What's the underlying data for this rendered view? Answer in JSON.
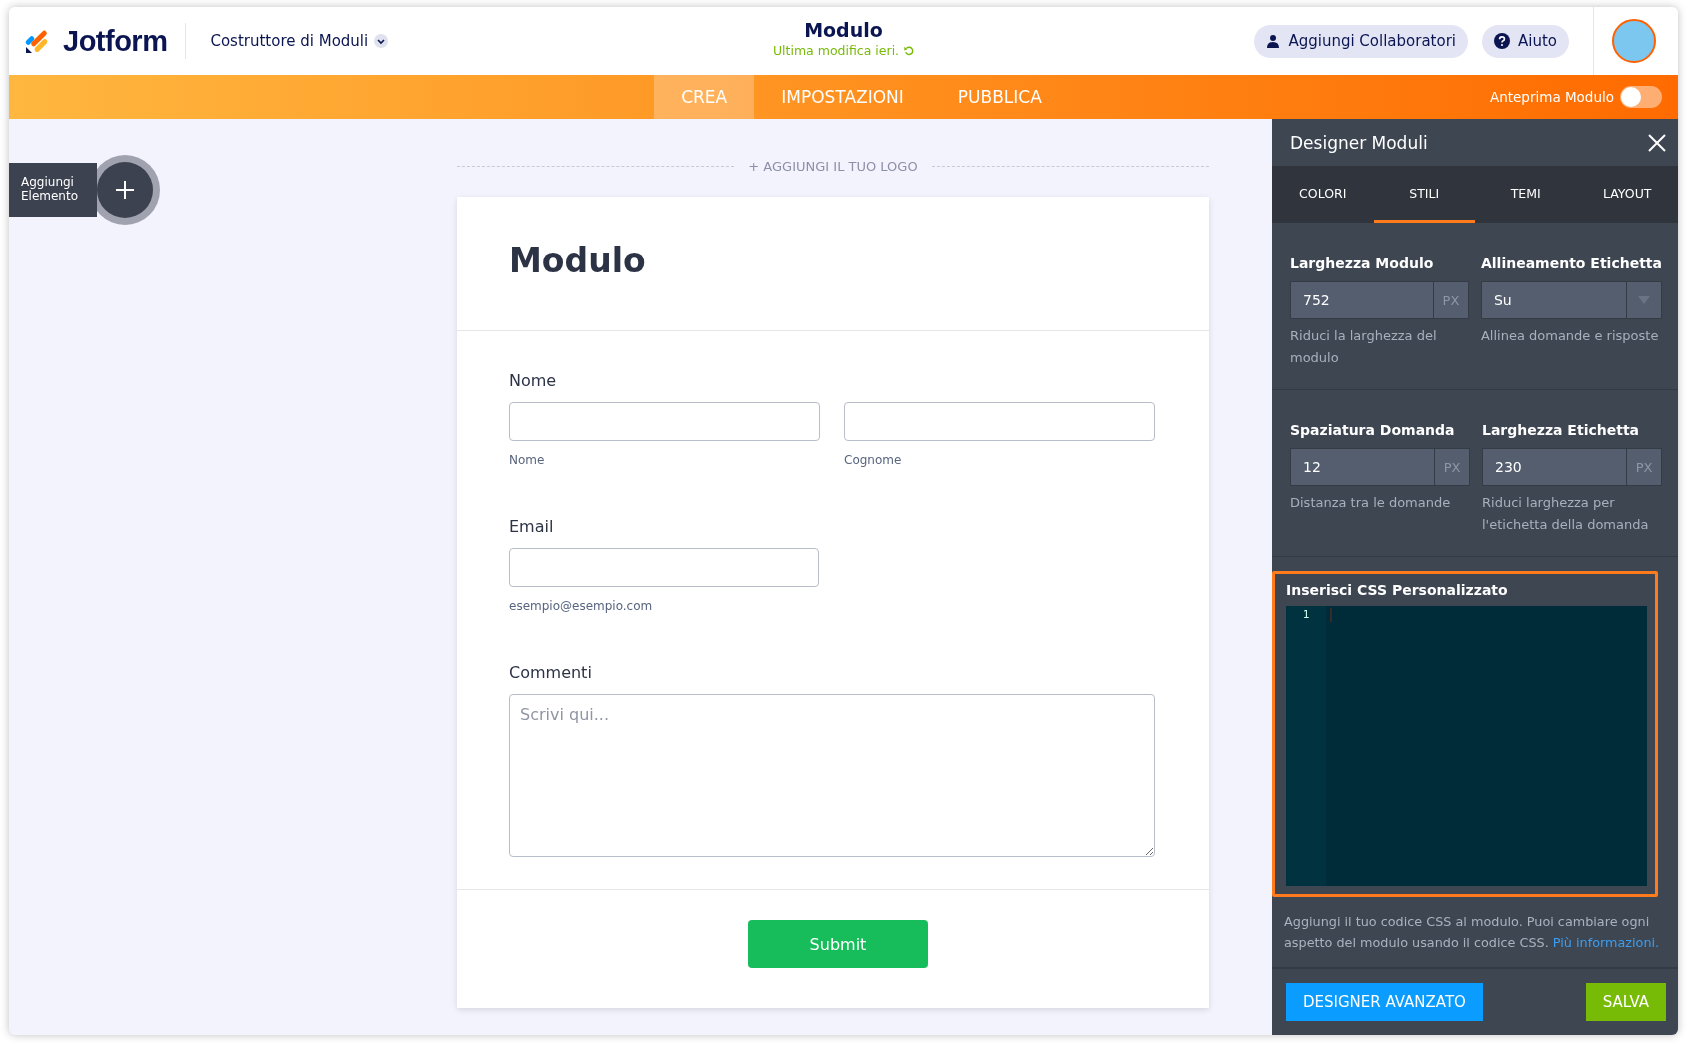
{
  "header": {
    "logo": "Jotform",
    "builder_menu": "Costruttore di Moduli",
    "title": "Modulo",
    "subtitle": "Ultima modifica ieri.",
    "buttons": [
      {
        "kind": "people",
        "label": "Aggiungi Collaboratori"
      },
      {
        "kind": "help",
        "label": "Aiuto"
      }
    ]
  },
  "nav": {
    "tabs": [
      {
        "label": "CREA",
        "selected": true
      },
      {
        "label": "IMPOSTAZIONI",
        "selected": false
      },
      {
        "label": "PUBBLICA",
        "selected": false
      }
    ],
    "preview": {
      "label": "Anteprima Modulo",
      "on": false
    }
  },
  "add_element": {
    "label": "Aggiungi Elemento"
  },
  "logo_placeholder": "+ AGGIUNGI IL TUO LOGO",
  "form": {
    "title": "Modulo",
    "fields": [
      {
        "kind": "name",
        "label": "Nome",
        "sublabels": [
          "Nome",
          "Cognome"
        ]
      },
      {
        "kind": "email",
        "label": "Email",
        "sublabels": [
          "esempio@esempio.com"
        ]
      },
      {
        "kind": "textarea",
        "label": "Commenti",
        "placeholder": "Scrivi qui..."
      }
    ],
    "submit": "Submit"
  },
  "designer": {
    "title": "Designer Moduli",
    "tabs": [
      {
        "label": "COLORI",
        "selected": false
      },
      {
        "label": "STILI",
        "selected": true
      },
      {
        "label": "TEMI",
        "selected": false
      },
      {
        "label": "LAYOUT",
        "selected": false
      }
    ],
    "settings": [
      {
        "kind": "number",
        "label": "Larghezza Modulo",
        "value": "752",
        "unit": "PX",
        "help": "Riduci la larghezza del modulo"
      },
      {
        "kind": "select",
        "label": "Allineamento Etichetta",
        "value": "Su",
        "help": "Allinea domande e risposte"
      },
      {
        "kind": "number",
        "label": "Spaziatura Domanda",
        "value": "12",
        "unit": "PX",
        "help": "Distanza tra le domande"
      },
      {
        "kind": "number",
        "label": "Larghezza Etichetta",
        "value": "230",
        "unit": "PX",
        "help": "Riduci larghezza per l'etichetta della domanda"
      }
    ],
    "css": {
      "label": "Inserisci CSS Personalizzato",
      "line_numbers": [
        "1"
      ],
      "help": "Aggiungi il tuo codice CSS al modulo. Puoi cambiare ogni aspetto del modulo usando il codice CSS.",
      "link": "Più informazioni."
    },
    "buttons": [
      {
        "kind": "advanced",
        "label": "DESIGNER AVANZATO"
      },
      {
        "kind": "save",
        "label": "SALVA"
      }
    ]
  }
}
